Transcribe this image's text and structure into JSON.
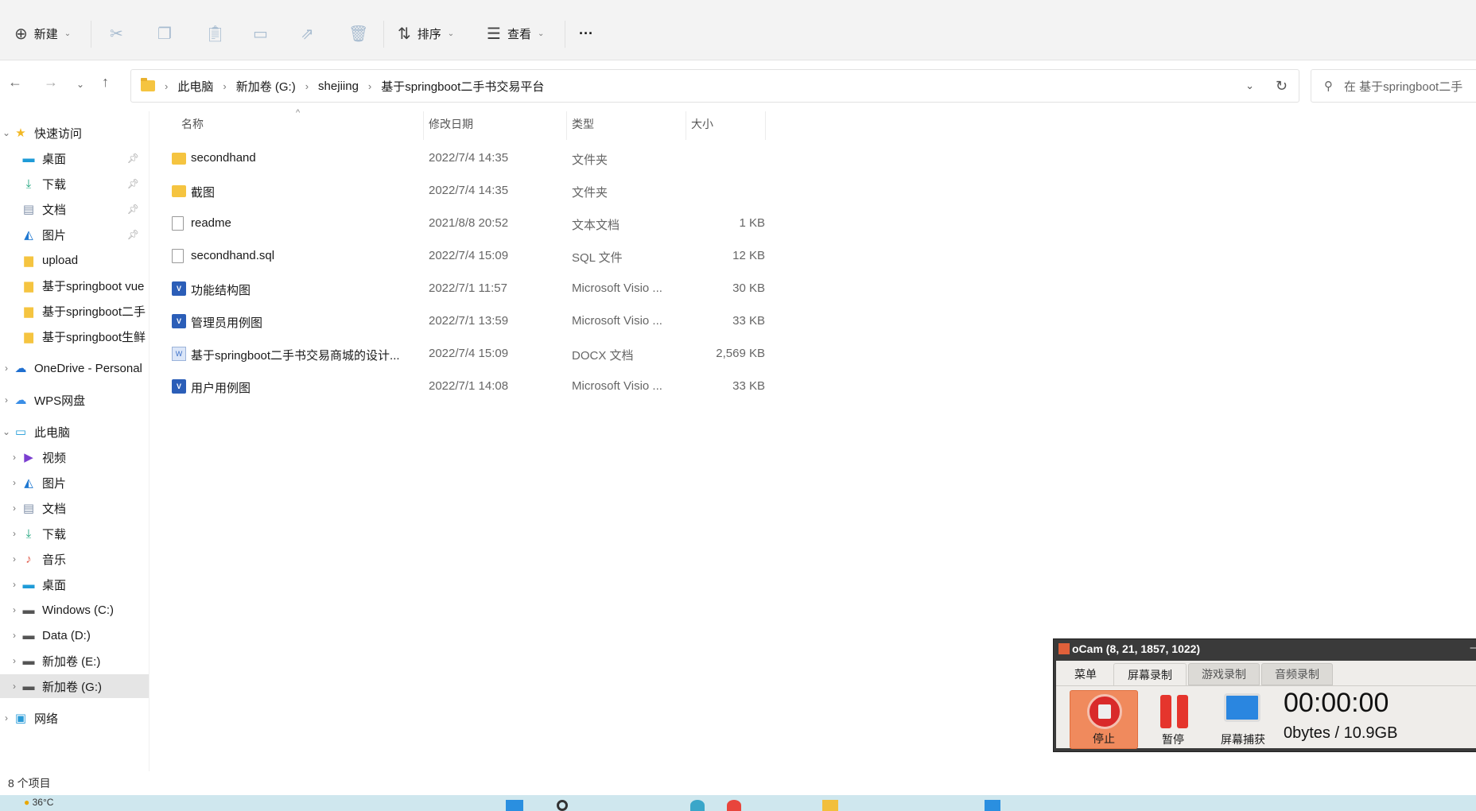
{
  "toolbar": {
    "new_label": "新建",
    "sort_label": "排序",
    "view_label": "查看",
    "more_label": "···"
  },
  "address": {
    "crumbs": [
      "此电脑",
      "新加卷 (G:)",
      "shejiing",
      "基于springboot二手书交易平台"
    ]
  },
  "search": {
    "placeholder": "在 基于springboot二手"
  },
  "sidebar": {
    "items": [
      {
        "label": "快速访问",
        "icon": "star-icon",
        "chev": "⌄",
        "level": 0,
        "pin": false
      },
      {
        "label": "桌面",
        "icon": "desktop-icon",
        "chev": "",
        "level": 1,
        "pin": true
      },
      {
        "label": "下载",
        "icon": "download-icon",
        "chev": "",
        "level": 1,
        "pin": true
      },
      {
        "label": "文档",
        "icon": "document-icon",
        "chev": "",
        "level": 1,
        "pin": true
      },
      {
        "label": "图片",
        "icon": "pictures-icon",
        "chev": "",
        "level": 1,
        "pin": true
      },
      {
        "label": "upload",
        "icon": "folder-icon",
        "chev": "",
        "level": 1,
        "pin": false
      },
      {
        "label": "基于springboot vue",
        "icon": "folder-icon",
        "chev": "",
        "level": 1,
        "pin": false
      },
      {
        "label": "基于springboot二手",
        "icon": "folder-icon",
        "chev": "",
        "level": 1,
        "pin": false
      },
      {
        "label": "基于springboot生鲜",
        "icon": "folder-icon",
        "chev": "",
        "level": 1,
        "pin": false
      },
      {
        "label": "OneDrive - Personal",
        "icon": "onedrive-icon",
        "chev": "›",
        "level": 0,
        "pin": false
      },
      {
        "label": "WPS网盘",
        "icon": "wps-cloud-icon",
        "chev": "›",
        "level": 0,
        "pin": false
      },
      {
        "label": "此电脑",
        "icon": "computer-icon",
        "chev": "⌄",
        "level": 0,
        "pin": false
      },
      {
        "label": "视频",
        "icon": "video-icon",
        "chev": "›",
        "level": 1,
        "pin": false
      },
      {
        "label": "图片",
        "icon": "pictures-icon",
        "chev": "›",
        "level": 1,
        "pin": false
      },
      {
        "label": "文档",
        "icon": "document-icon",
        "chev": "›",
        "level": 1,
        "pin": false
      },
      {
        "label": "下载",
        "icon": "download-icon",
        "chev": "›",
        "level": 1,
        "pin": false
      },
      {
        "label": "音乐",
        "icon": "music-icon",
        "chev": "›",
        "level": 1,
        "pin": false
      },
      {
        "label": "桌面",
        "icon": "desktop-icon",
        "chev": "›",
        "level": 1,
        "pin": false
      },
      {
        "label": "Windows (C:)",
        "icon": "drive-icon",
        "chev": "›",
        "level": 1,
        "pin": false
      },
      {
        "label": "Data (D:)",
        "icon": "drive-icon",
        "chev": "›",
        "level": 1,
        "pin": false
      },
      {
        "label": "新加卷 (E:)",
        "icon": "drive-icon",
        "chev": "›",
        "level": 1,
        "pin": false
      },
      {
        "label": "新加卷 (G:)",
        "icon": "drive-icon",
        "chev": "›",
        "level": 1,
        "pin": false,
        "selected": true
      },
      {
        "label": "网络",
        "icon": "network-icon",
        "chev": "›",
        "level": 0,
        "pin": false
      }
    ]
  },
  "columns": {
    "name": "名称",
    "date": "修改日期",
    "type": "类型",
    "size": "大小"
  },
  "files": [
    {
      "name": "secondhand",
      "date": "2022/7/4 14:35",
      "type": "文件夹",
      "size": "",
      "icon": "folder"
    },
    {
      "name": "截图",
      "date": "2022/7/4 14:35",
      "type": "文件夹",
      "size": "",
      "icon": "folder"
    },
    {
      "name": "readme",
      "date": "2021/8/8 20:52",
      "type": "文本文档",
      "size": "1 KB",
      "icon": "text"
    },
    {
      "name": "secondhand.sql",
      "date": "2022/7/4 15:09",
      "type": "SQL 文件",
      "size": "12 KB",
      "icon": "file"
    },
    {
      "name": "功能结构图",
      "date": "2022/7/1 11:57",
      "type": "Microsoft Visio ...",
      "size": "30 KB",
      "icon": "visio"
    },
    {
      "name": "管理员用例图",
      "date": "2022/7/1 13:59",
      "type": "Microsoft Visio ...",
      "size": "33 KB",
      "icon": "visio"
    },
    {
      "name": "基于springboot二手书交易商城的设计...",
      "date": "2022/7/4 15:09",
      "type": "DOCX 文档",
      "size": "2,569 KB",
      "icon": "word"
    },
    {
      "name": "用户用例图",
      "date": "2022/7/1 14:08",
      "type": "Microsoft Visio ...",
      "size": "33 KB",
      "icon": "visio"
    }
  ],
  "status": {
    "count": "8 个项目"
  },
  "taskbar": {
    "weather": "36°C"
  },
  "ocam": {
    "title": "oCam (8, 21, 1857, 1022)",
    "tabs": [
      "菜单",
      "屏幕录制",
      "游戏录制",
      "音频录制"
    ],
    "stop": "停止",
    "pause": "暂停",
    "capture": "屏幕捕获",
    "time": "00:00:00",
    "size": "0bytes / 10.9GB"
  }
}
